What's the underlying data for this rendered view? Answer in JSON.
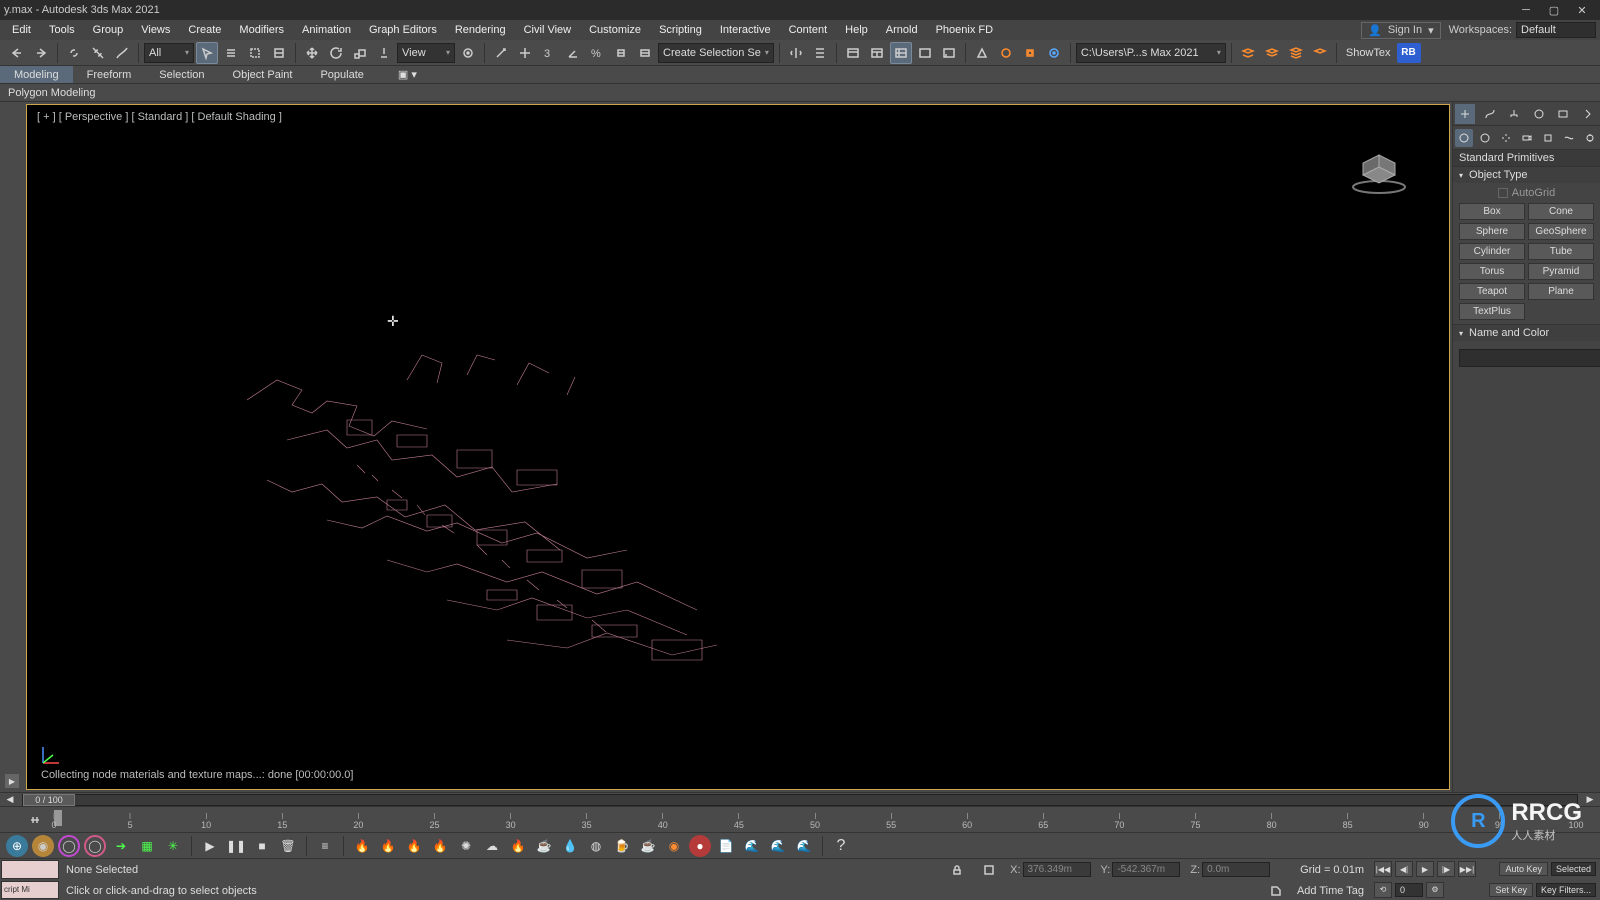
{
  "title": "y.max - Autodesk 3ds Max 2021",
  "menus": [
    "Edit",
    "Tools",
    "Group",
    "Views",
    "Create",
    "Modifiers",
    "Animation",
    "Graph Editors",
    "Rendering",
    "Civil View",
    "Customize",
    "Scripting",
    "Interactive",
    "Content",
    "Help",
    "Arnold",
    "Phoenix FD"
  ],
  "signin": "Sign In",
  "workspaces_label": "Workspaces:",
  "workspaces_value": "Default",
  "toolbar": {
    "filter": "All",
    "view": "View",
    "selset": "Create Selection Se",
    "path": "C:\\Users\\P...s Max 2021",
    "showtex": "ShowTex",
    "rb": "RB"
  },
  "ribbon_tabs": [
    "Modeling",
    "Freeform",
    "Selection",
    "Object Paint",
    "Populate"
  ],
  "ribbon_sub": "Polygon Modeling",
  "viewport": {
    "label": "[ + ] [ Perspective ] [ Standard ] [ Default Shading ]",
    "status": "Collecting node materials and texture maps...: done [00:00:00.0]"
  },
  "cmdpanel": {
    "subtitle": "Standard Primitives",
    "object_type": "Object Type",
    "autogrid": "AutoGrid",
    "prims": [
      "Box",
      "Cone",
      "Sphere",
      "GeoSphere",
      "Cylinder",
      "Tube",
      "Torus",
      "Pyramid",
      "Teapot",
      "Plane",
      "TextPlus"
    ],
    "name_color": "Name and Color"
  },
  "trackbar": {
    "thumb": "0 / 100"
  },
  "timeline": {
    "ticks": [
      0,
      5,
      10,
      15,
      20,
      25,
      30,
      35,
      40,
      45,
      50,
      55,
      60,
      65,
      70,
      75,
      80,
      85,
      90,
      95,
      100
    ]
  },
  "status": {
    "mini": "cript Mi",
    "selection": "None Selected",
    "prompt": "Click or click-and-drag to select objects",
    "x_label": "X:",
    "x_val": "376.349m",
    "y_label": "Y:",
    "y_val": "-542.367m",
    "z_label": "Z:",
    "z_val": "0.0m",
    "grid": "Grid = 0.01m",
    "addtag": "Add Time Tag",
    "autokey": "Auto Key",
    "selected": "Selected",
    "setkey": "Set Key",
    "keyfilters": "Key Filters..."
  },
  "watermark": {
    "ring": "R",
    "text": "RRCG",
    "sub": "人人素材"
  }
}
